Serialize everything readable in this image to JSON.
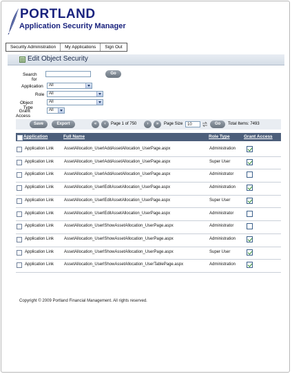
{
  "brand": {
    "title": "PORTLAND",
    "subtitle": "Application Security Manager"
  },
  "nav": [
    {
      "label": "Security Administration"
    },
    {
      "label": "My Applications"
    },
    {
      "label": "Sign Out"
    }
  ],
  "section": {
    "title": "Edit Object Security"
  },
  "filters": {
    "search_label": "Search for",
    "search_value": "",
    "go_label": "Go",
    "application_label": "Application",
    "application_value": "All",
    "role_label": "Role",
    "role_value": "All",
    "object_type_label": "Object Type",
    "object_type_value": "All",
    "grant_access_label": "Grant Access",
    "grant_access_value": "All"
  },
  "toolbar": {
    "save_label": "Save",
    "export_label": "Export",
    "first_icon": "«",
    "prev_icon": "‹",
    "page_text": "Page 1 of 750",
    "next_icon": "›",
    "last_icon": "»",
    "page_size_label": "Page Size",
    "page_size_value": "10",
    "go_label": "Go",
    "total_items": "Total Items: 7493"
  },
  "table": {
    "columns": {
      "application": "Application",
      "full_name": "Full Name",
      "role_type": "Role Type",
      "grant_access": "Grant Access"
    },
    "rows": [
      {
        "application": "Application Link",
        "full_name": "AssetAllocation_UserlAddAssetAllocation_UserPage.aspx",
        "role_type": "Administration",
        "granted": true
      },
      {
        "application": "Application Link",
        "full_name": "AssetAllocation_UserlAddAssetAllocation_UserPage.aspx",
        "role_type": "Super User",
        "granted": true
      },
      {
        "application": "Application Link",
        "full_name": "AssetAllocation_UserlAddAssetAllocation_UserPage.aspx",
        "role_type": "Administrator",
        "granted": false
      },
      {
        "application": "Application Link",
        "full_name": "AssetAllocation_UserlEditAssetAllocation_UserPage.aspx",
        "role_type": "Administration",
        "granted": true
      },
      {
        "application": "Application Link",
        "full_name": "AssetAllocation_UserlEditAssetAllocation_UserPage.aspx",
        "role_type": "Super User",
        "granted": true
      },
      {
        "application": "Application Link",
        "full_name": "AssetAllocation_UserlEditAssetAllocation_UserPage.aspx",
        "role_type": "Administrator",
        "granted": false
      },
      {
        "application": "Application Link",
        "full_name": "AssetAllocation_UserlShowAssetAllocation_UserPage.aspx",
        "role_type": "Administrator",
        "granted": false
      },
      {
        "application": "Application Link",
        "full_name": "AssetAllocation_UserlShowAssetAllocation_UserPage.aspx",
        "role_type": "Administration",
        "granted": true
      },
      {
        "application": "Application Link",
        "full_name": "AssetAllocation_UserlShowAssetAllocation_UserPage.aspx",
        "role_type": "Super User",
        "granted": true
      },
      {
        "application": "Application Link",
        "full_name": "AssetAllocation_UserlShowAssetAllocation_UserTablePage.aspx",
        "role_type": "Administration",
        "granted": true
      }
    ]
  },
  "footer": {
    "copyright": "Copyright © 2009 Portland Financial Management. All rights reserved."
  },
  "colors": {
    "brand": "#1a237e",
    "header_bar": "#4c5e7a",
    "button": "#7d8791",
    "check": "#2e8b2e"
  }
}
